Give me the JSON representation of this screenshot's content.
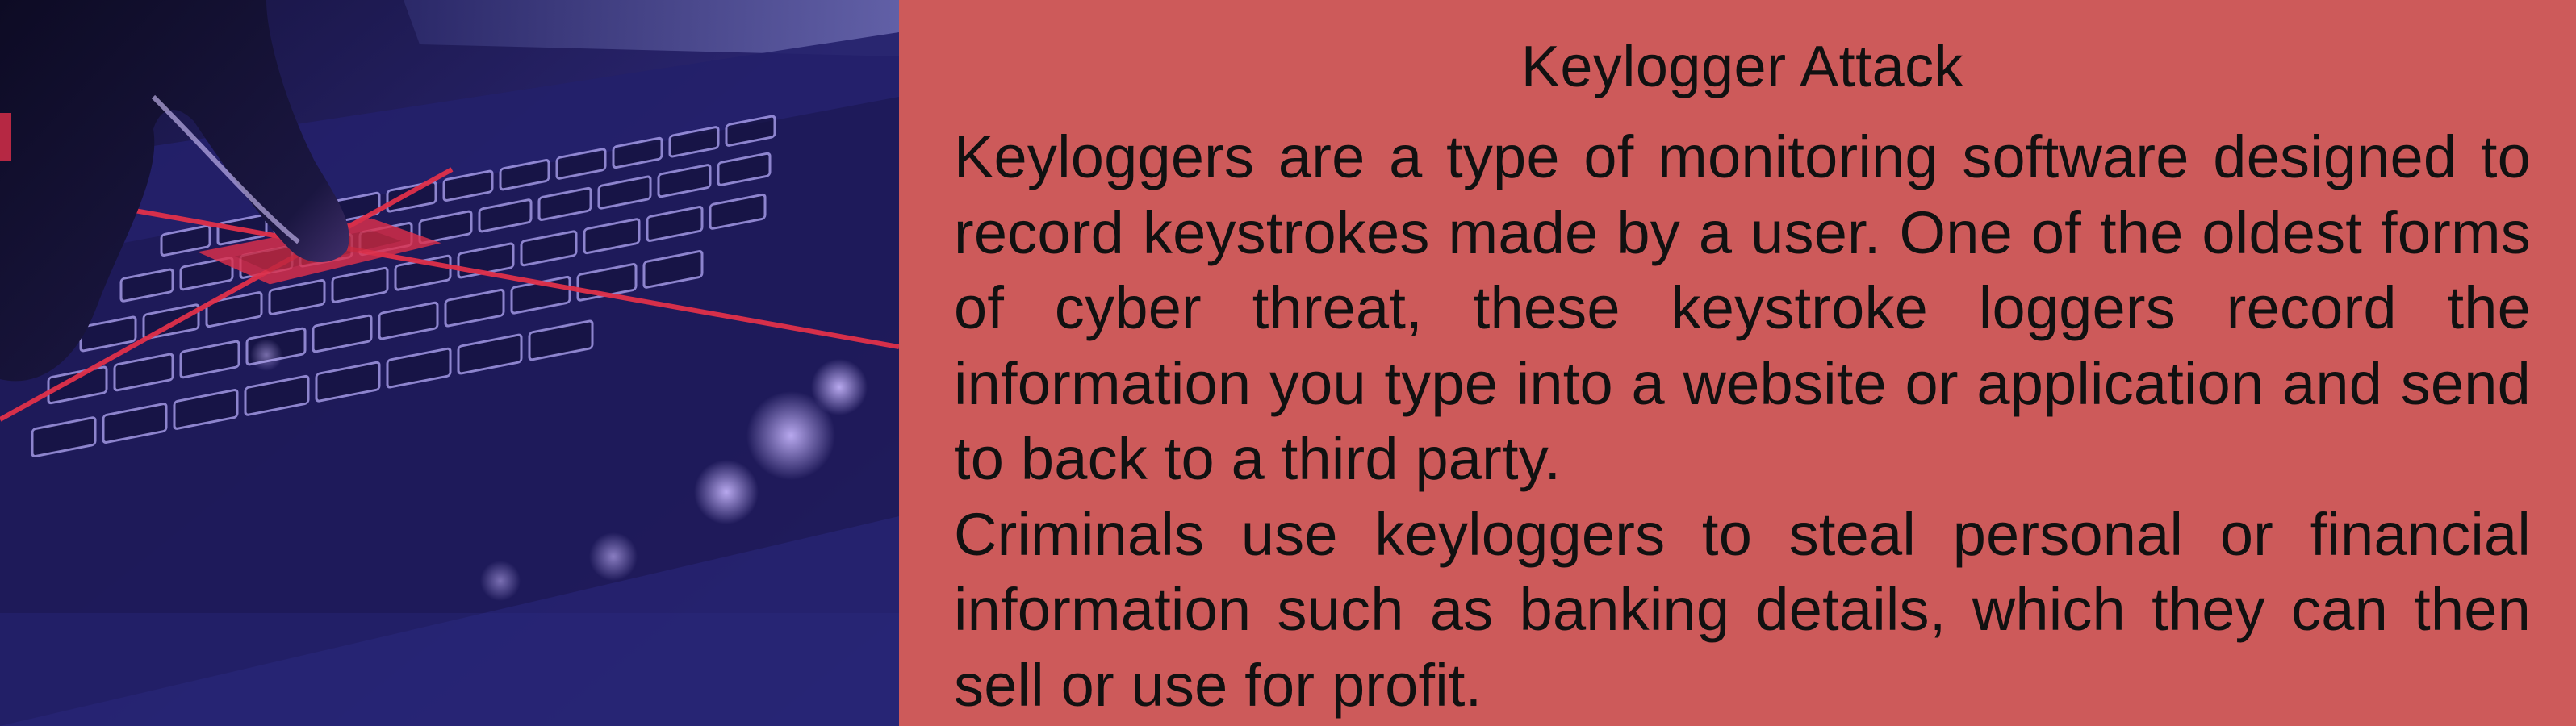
{
  "image": {
    "description_icon": "hacker-finger-pressing-laptop-key-photo",
    "accent_color": "#e0304a",
    "base_color": "#1e1a52"
  },
  "content": {
    "title": "Keylogger Attack",
    "paragraph_1": "Keyloggers are a type of monitoring software designed to record keystrokes made by a user. One of the oldest forms of cyber threat, these keystroke loggers record the information you type into a website or application and send to back to a third party.",
    "paragraph_2": "Criminals use keyloggers to steal personal or financial information such as banking details, which they can then sell or use for profit."
  },
  "colors": {
    "panel_background": "#cd5a5a",
    "text": "#111111"
  }
}
